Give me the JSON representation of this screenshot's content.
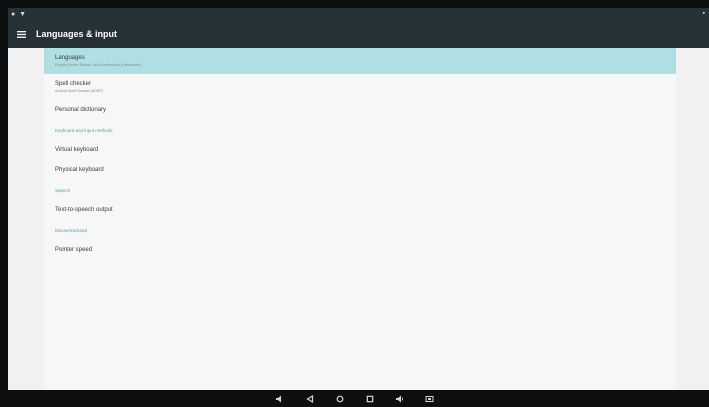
{
  "app": {
    "title": "Languages & input"
  },
  "items": {
    "languages": {
      "title": "Languages",
      "subtitle": "English (United States), Lao (Cambodian) (Democratic)"
    },
    "spell_checker": {
      "title": "Spell checker",
      "subtitle": "Android Spell Checker (AOSP)"
    },
    "personal_dictionary": {
      "title": "Personal dictionary"
    },
    "keyboard_header": {
      "title": "Keyboard and input methods"
    },
    "virtual_keyboard": {
      "title": "Virtual keyboard"
    },
    "physical_keyboard": {
      "title": "Physical keyboard"
    },
    "speech_header": {
      "title": "Speech"
    },
    "tts_output": {
      "title": "Text-to-speech output"
    },
    "mouse_header": {
      "title": "Mouse/trackpad"
    },
    "pointer_speed": {
      "title": "Pointer speed"
    }
  },
  "nav": {
    "icons": [
      "volume-down-icon",
      "back-icon",
      "home-icon",
      "recents-icon",
      "volume-up-icon",
      "screenshot-icon"
    ]
  }
}
